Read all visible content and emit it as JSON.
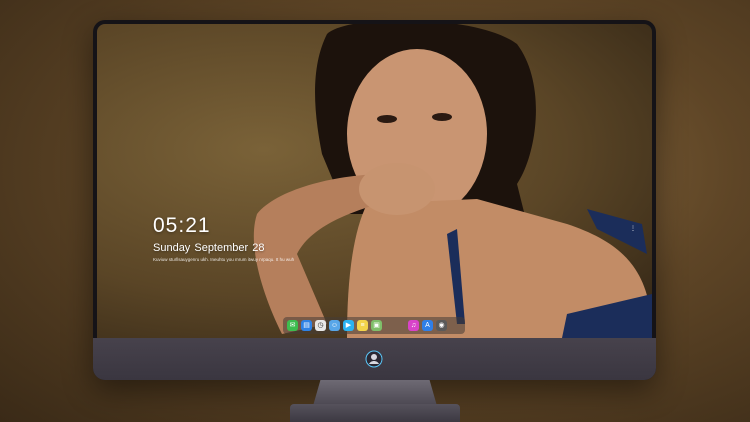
{
  "lock_screen": {
    "time": "05:21",
    "date": "Sunday September  28",
    "subtext": "Kuviuw sturllsauygenru ukh. Ineuhtu you mrum itwuy nrpaqu. It hu wuh"
  },
  "dock": {
    "apps": [
      {
        "name": "messages-app-icon",
        "color": "#3dbd4e",
        "glyph": "✉"
      },
      {
        "name": "files-app-icon",
        "color": "#2e82e6",
        "glyph": "▤"
      },
      {
        "name": "clock-app-icon",
        "color": "#e8e8e8",
        "glyph": "◷"
      },
      {
        "name": "finder-app-icon",
        "color": "#58a6e8",
        "glyph": "☺"
      },
      {
        "name": "video-app-icon",
        "color": "#2bb3f0",
        "glyph": "▶"
      },
      {
        "name": "notes-app-icon",
        "color": "#f3d44a",
        "glyph": "≡"
      },
      {
        "name": "photos-app-icon",
        "color": "#7fbf6a",
        "glyph": "▣"
      },
      {
        "name": "music-app-icon",
        "color": "#d843c9",
        "glyph": "♫"
      },
      {
        "name": "appstore-app-icon",
        "color": "#2f7fe8",
        "glyph": "A"
      },
      {
        "name": "camera-app-icon",
        "color": "#5a5a5a",
        "glyph": "◉"
      }
    ]
  },
  "colors": {
    "monitor_bezel": "#151317",
    "monitor_chin": "#433f48",
    "logo_accent": "#5ac8fa"
  }
}
